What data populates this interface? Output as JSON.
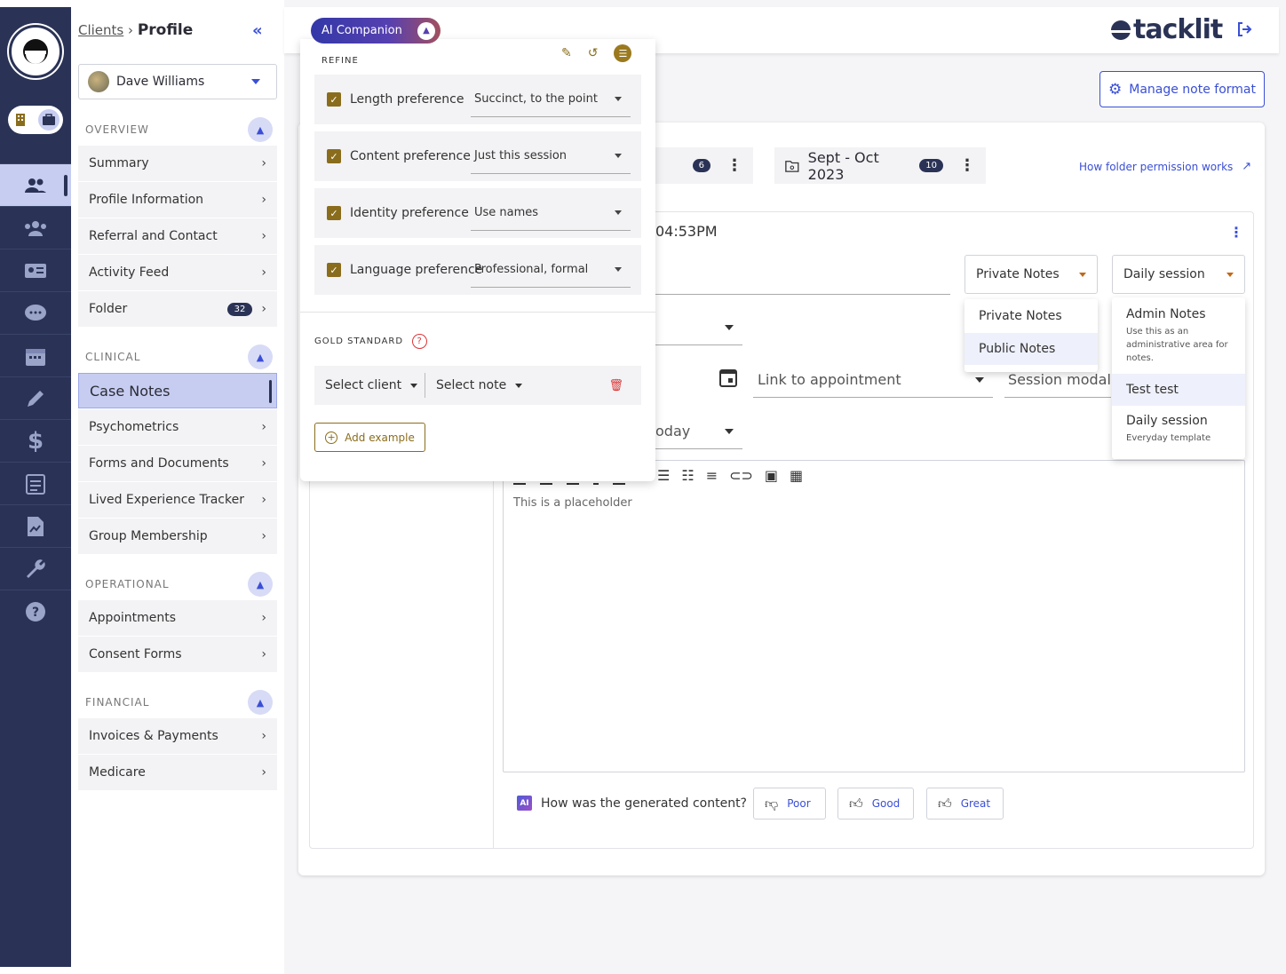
{
  "breadcrumb": {
    "parent": "Clients",
    "separator": "›",
    "current": "Profile"
  },
  "client": {
    "name": "Dave Williams"
  },
  "sections": {
    "overview": {
      "title": "OVERVIEW",
      "items": [
        "Summary",
        "Profile Information",
        "Referral and Contact",
        "Activity Feed",
        "Folder"
      ],
      "folder_count": "32"
    },
    "clinical": {
      "title": "CLINICAL",
      "items": [
        "Case Notes",
        "Psychometrics",
        "Forms and Documents",
        "Lived Experience Tracker",
        "Group Membership"
      ]
    },
    "operational": {
      "title": "OPERATIONAL",
      "items": [
        "Appointments",
        "Consent Forms"
      ]
    },
    "financial": {
      "title": "FINANCIAL",
      "items": [
        "Invoices & Payments",
        "Medicare"
      ]
    }
  },
  "brand": {
    "name": "tacklit",
    "color": "#2a3356"
  },
  "header": {
    "manage_label": "Manage note format"
  },
  "folders": {
    "first_count": "6",
    "second_label": "Sept - Oct 2023",
    "second_count": "10",
    "permission_link": "How folder permission works"
  },
  "note": {
    "timestamp": "04:53PM",
    "privacy_value": "Private Notes",
    "template_value": "Daily session",
    "link_appointment": "Link to appointment",
    "session_modality": "Session modality",
    "date_partial": "oday",
    "placeholder": "This is a placeholder"
  },
  "privacy_options": [
    "Private Notes",
    "Public Notes"
  ],
  "template_options": [
    {
      "title": "Admin Notes",
      "sub": "Use this as an administrative area for notes."
    },
    {
      "title": "Test test",
      "sub": ""
    },
    {
      "title": "Daily session",
      "sub": "Everyday template"
    }
  ],
  "feedback": {
    "question": "How was the generated content?",
    "ai_mark": "AI",
    "poor": "Poor",
    "good": "Good",
    "great": "Great"
  },
  "ai": {
    "pill_label": "AI Companion",
    "refine_label": "REFINE",
    "prefs": [
      {
        "label": "Length preference",
        "value": "Succinct, to the point"
      },
      {
        "label": "Content preference",
        "value": "Just this session"
      },
      {
        "label": "Identity preference",
        "value": "Use names"
      },
      {
        "label": "Language preference",
        "value": "Professional, formal"
      }
    ],
    "gold_label": "GOLD STANDARD",
    "select_client": "Select client",
    "select_note": "Select note",
    "add_example": "Add example"
  },
  "colors": {
    "rail": "#2a3356",
    "accent": "#3a4fd6",
    "active_nav": "#c7cdf1",
    "gold": "#8a6d1c"
  }
}
